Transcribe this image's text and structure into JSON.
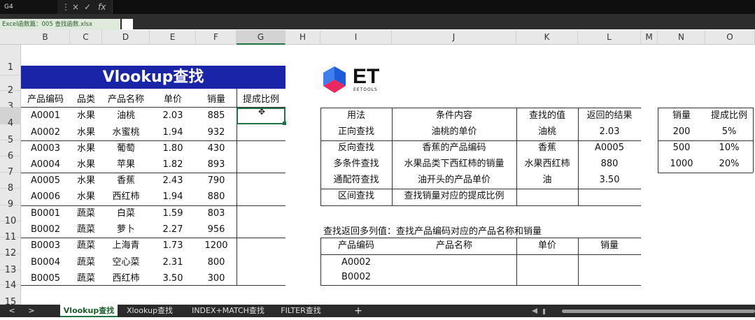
{
  "formula_bar": {
    "name_box": "G4",
    "cancel_icon": "×",
    "enter_icon": "✓",
    "fx_icon": "fx",
    "more_icon": "⋮"
  },
  "file_tab": {
    "label": "Excel函数篇：005 查找函数.xlsx"
  },
  "columns": [
    "B",
    "C",
    "D",
    "E",
    "F",
    "G",
    "H",
    "I",
    "J",
    "K",
    "L",
    "M",
    "N",
    "O"
  ],
  "rows": [
    "1",
    "2",
    "3",
    "4",
    "5",
    "6",
    "7",
    "8",
    "9",
    "10",
    "11",
    "12",
    "13",
    "14",
    "15"
  ],
  "left_table": {
    "title": "Vlookup查找",
    "headers": [
      "产品编码",
      "品类",
      "产品名称",
      "单价",
      "销量",
      "提成比例"
    ],
    "rows": [
      [
        "A0001",
        "水果",
        "油桃",
        "2.03",
        "885"
      ],
      [
        "A0002",
        "水果",
        "水蜜桃",
        "1.94",
        "932"
      ],
      [
        "A0003",
        "水果",
        "葡萄",
        "1.80",
        "430"
      ],
      [
        "A0004",
        "水果",
        "苹果",
        "1.82",
        "893"
      ],
      [
        "A0005",
        "水果",
        "香蕉",
        "2.43",
        "790"
      ],
      [
        "A0006",
        "水果",
        "西红柿",
        "1.94",
        "880"
      ],
      [
        "B0001",
        "蔬菜",
        "白菜",
        "1.59",
        "803"
      ],
      [
        "B0002",
        "蔬菜",
        "萝卜",
        "2.27",
        "956"
      ],
      [
        "B0003",
        "蔬菜",
        "上海青",
        "1.73",
        "1200"
      ],
      [
        "B0004",
        "蔬菜",
        "空心菜",
        "2.31",
        "800"
      ],
      [
        "B0005",
        "蔬菜",
        "西红柿",
        "3.50",
        "300"
      ]
    ]
  },
  "logo": {
    "brand": "ET",
    "sub": "EETOOLS"
  },
  "lookup_table": {
    "headers": [
      "用法",
      "条件内容",
      "查找的值",
      "返回的结果"
    ],
    "rows": [
      [
        "正向查找",
        "油桃的单价",
        "油桃",
        "2.03"
      ],
      [
        "反向查找",
        "香蕉的产品编码",
        "香蕉",
        "A0005"
      ],
      [
        "多条件查找",
        "水果品类下西红柿的销量",
        "水果西红柿",
        "880"
      ],
      [
        "通配符查找",
        "油开头的产品单价",
        "油",
        "3.50"
      ],
      [
        "区间查找",
        "查找销量对应的提成比例",
        "",
        ""
      ]
    ]
  },
  "rate_table": {
    "headers": [
      "销量",
      "提成比例"
    ],
    "rows": [
      [
        "200",
        "5%"
      ],
      [
        "500",
        "10%"
      ],
      [
        "1000",
        "20%"
      ]
    ]
  },
  "multi_col": {
    "caption": "查找返回多列值：查找产品编码对应的产品名称和销量",
    "headers": [
      "产品编码",
      "产品名称",
      "单价",
      "销量"
    ],
    "rows": [
      [
        "A0002"
      ],
      [
        "B0002"
      ]
    ]
  },
  "sheet_tabs": [
    "Vlookup查找",
    "Xlookup查找",
    "INDEX+MATCH查找",
    "FILTER查找"
  ],
  "sheet_nav": {
    "prev": "<",
    "next": ">",
    "add": "+"
  },
  "colors": {
    "banner": "#1a24a8",
    "excel_green": "#217346",
    "logo_blue": "#1e5bd6",
    "logo_pink": "#e8285f"
  }
}
